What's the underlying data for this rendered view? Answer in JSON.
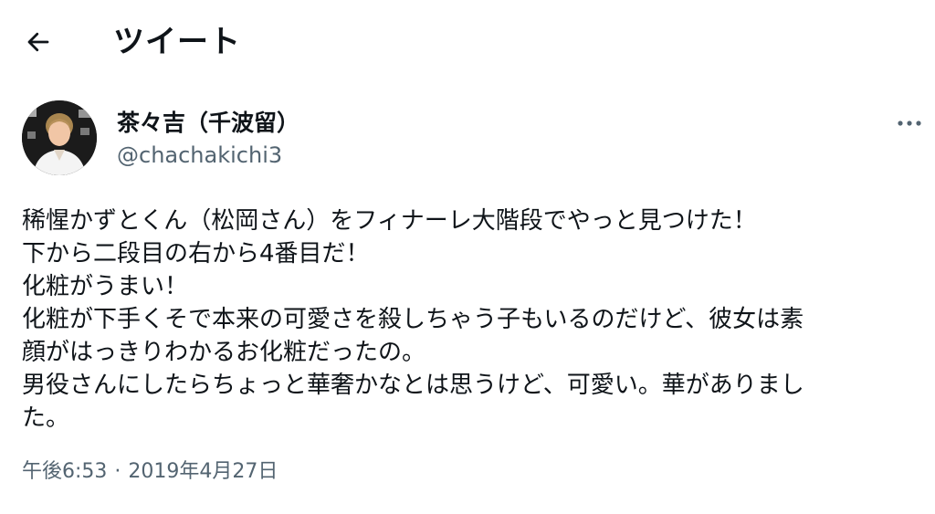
{
  "header": {
    "back_icon": "arrow-left-icon",
    "title": "ツイート"
  },
  "tweet": {
    "author": {
      "name": "茶々吉（千波留）",
      "handle": "@chachakichi3",
      "avatar_icon": "user-avatar-photo"
    },
    "more_icon": "more-horizontal-icon",
    "lines": [
      "稀惺かずとくん（松岡さん）をフィナーレ大階段でやっと見つけた！",
      "下から二段目の右から4番目だ！",
      "化粧がうまい！",
      "化粧が下手くそで本来の可愛さを殺しちゃう子もいるのだけど、彼女は素",
      "顔がはっきりわかるお化粧だったの。",
      "男役さんにしたらちょっと華奢かなとは思うけど、可愛い。華がありまし",
      "た。"
    ],
    "time": "午後6:53",
    "separator": "·",
    "date": "2019年4月27日"
  },
  "colors": {
    "text_primary": "#0f1419",
    "text_secondary": "#536471",
    "background": "#ffffff"
  }
}
